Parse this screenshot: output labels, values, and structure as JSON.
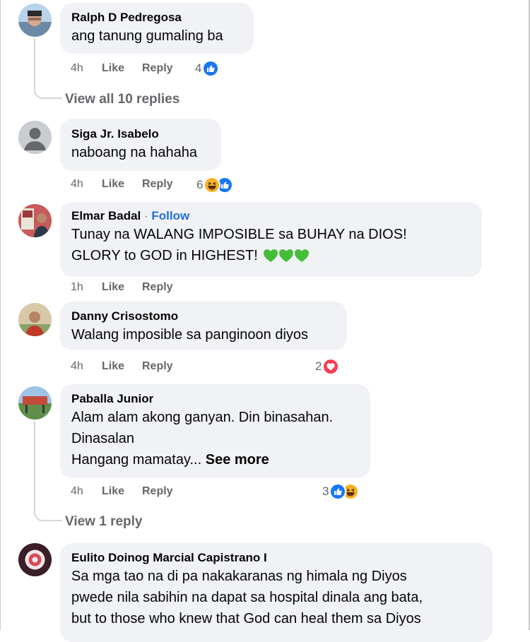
{
  "comments": [
    {
      "author": "Ralph D Pedregosa",
      "lines": [
        "ang tanung gumaling ba"
      ],
      "time": "4h",
      "like_label": "Like",
      "reply_label": "Reply",
      "reaction_count": "4",
      "reactions": [
        "like-icon"
      ]
    },
    {
      "author": "Siga Jr. Isabelo",
      "lines": [
        "naboang na hahaha"
      ],
      "time": "4h",
      "like_label": "Like",
      "reply_label": "Reply",
      "reaction_count": "6",
      "reactions": [
        "haha-icon",
        "like-icon"
      ]
    },
    {
      "author": "Elmar Badal",
      "separator": "·",
      "follow_label": "Follow",
      "lines": [
        "Tunay na WALANG IMPOSIBLE sa BUHAY na DIOS!",
        "GLORY to GOD in HIGHEST!"
      ],
      "emoji": [
        "green-heart-icon",
        "green-heart-icon",
        "green-heart-icon"
      ],
      "time": "1h",
      "like_label": "Like",
      "reply_label": "Reply"
    },
    {
      "author": "Danny Crisostomo",
      "lines": [
        "Walang imposible sa panginoon diyos"
      ],
      "time": "4h",
      "like_label": "Like",
      "reply_label": "Reply",
      "reaction_count": "2",
      "reactions": [
        "love-icon"
      ]
    },
    {
      "author": "Paballa Junior",
      "lines": [
        "Alam alam akong ganyan. Din binasahan.",
        "Dinasalan",
        "Hangang mamatay..."
      ],
      "see_more_label": "See more",
      "time": "4h",
      "like_label": "Like",
      "reply_label": "Reply",
      "reaction_count": "3",
      "reactions": [
        "like-icon",
        "haha-icon"
      ]
    },
    {
      "author": "Eulito Doinog Marcial Capistrano I",
      "lines": [
        "Sa mga tao na di pa nakakaranas ng himala ng Diyos",
        "pwede nila sabihin na dapat sa hospital dinala ang bata,",
        "but to those who knew that God can heal them sa Diyos"
      ]
    }
  ],
  "view_all_replies_1": "View all 10 replies",
  "view_replies_2": "View 1 reply",
  "colors": {
    "bubble": "#f0f2f5",
    "meta_text": "#65676b",
    "follow_link": "#216fdb",
    "like_blue": "#1877f2",
    "love_red": "#f33e58",
    "haha_yellow": "#f7b125",
    "green_heart": "#45bd3a"
  }
}
